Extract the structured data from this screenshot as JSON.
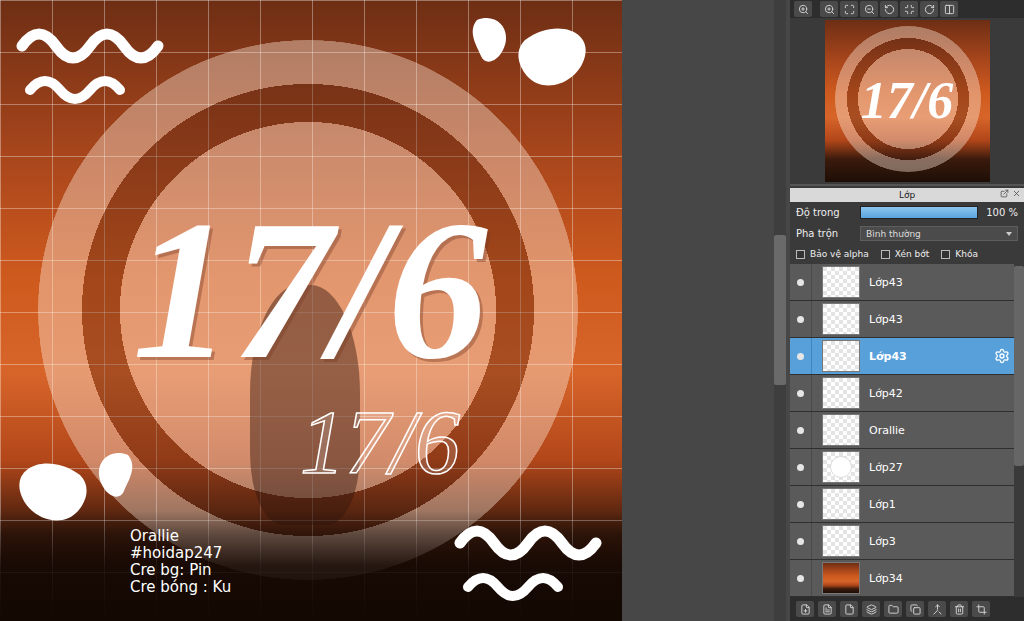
{
  "canvas": {
    "title": "17/6",
    "subtitle": "17/6",
    "credits": [
      "Orallie",
      "#hoidap247",
      "Cre bg: Pin",
      "Cre bóng : Ku"
    ]
  },
  "layers_panel": {
    "title": "Lớp",
    "opacity": {
      "label": "Độ trong",
      "level": 1,
      "reading": "100 %"
    },
    "blend": {
      "label": "Pha trộn",
      "value": "Bình thường"
    },
    "options": [
      {
        "label": "Bảo vệ alpha",
        "checked": false
      },
      {
        "label": "Xén bớt",
        "checked": false
      },
      {
        "label": "Khóa",
        "checked": false
      }
    ],
    "layers": [
      {
        "name": "Lớp43",
        "visible": true,
        "selected": false,
        "kind": "blank"
      },
      {
        "name": "Lớp43",
        "visible": true,
        "selected": false,
        "kind": "blank"
      },
      {
        "name": "Lớp43",
        "visible": true,
        "selected": true,
        "kind": "blank"
      },
      {
        "name": "Lớp42",
        "visible": true,
        "selected": false,
        "kind": "blank"
      },
      {
        "name": "Orallie",
        "visible": true,
        "selected": false,
        "kind": "blank"
      },
      {
        "name": "Lớp27",
        "visible": true,
        "selected": false,
        "kind": "circle"
      },
      {
        "name": "Lớp1",
        "visible": true,
        "selected": false,
        "kind": "blank"
      },
      {
        "name": "Lớp3",
        "visible": true,
        "selected": false,
        "kind": "blank"
      },
      {
        "name": "Lớp34",
        "visible": true,
        "selected": false,
        "kind": "photo"
      }
    ]
  }
}
